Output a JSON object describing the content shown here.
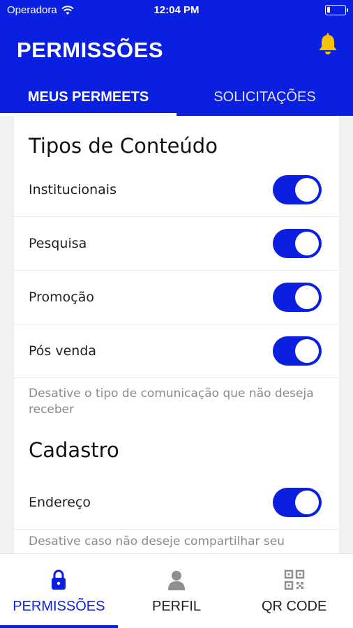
{
  "status_bar": {
    "carrier": "Operadora",
    "time": "12:04 PM",
    "battery_level": 0.1
  },
  "header": {
    "title": "PERMISSÕES",
    "notification_icon": "bell-icon",
    "bell_color": "#f5c400"
  },
  "tabs": [
    {
      "label": "MEUS PERMEETS",
      "active": true
    },
    {
      "label": "SOLICITAÇÕES",
      "active": false
    }
  ],
  "content_types": {
    "title": "Tipos de Conteúdo",
    "items": [
      {
        "label": "Institucionais",
        "enabled": true
      },
      {
        "label": "Pesquisa",
        "enabled": true
      },
      {
        "label": "Promoção",
        "enabled": true
      },
      {
        "label": "Pós venda",
        "enabled": true
      }
    ],
    "hint": "Desative o tipo de comunicação que não deseja receber"
  },
  "registration": {
    "title": "Cadastro",
    "items": [
      {
        "label": "Endereço",
        "enabled": true
      }
    ],
    "hint": "Desative caso não deseje compartilhar seu"
  },
  "bottom_nav": [
    {
      "label": "PERMISSÕES",
      "icon": "lock-icon",
      "active": true
    },
    {
      "label": "PERFIL",
      "icon": "person-icon",
      "active": false
    },
    {
      "label": "QR CODE",
      "icon": "qr-code-icon",
      "active": false
    }
  ],
  "colors": {
    "brand_blue": "#0a1fe0",
    "inactive_icon": "#8f8f8f",
    "hint_text": "#8a8a8a"
  }
}
